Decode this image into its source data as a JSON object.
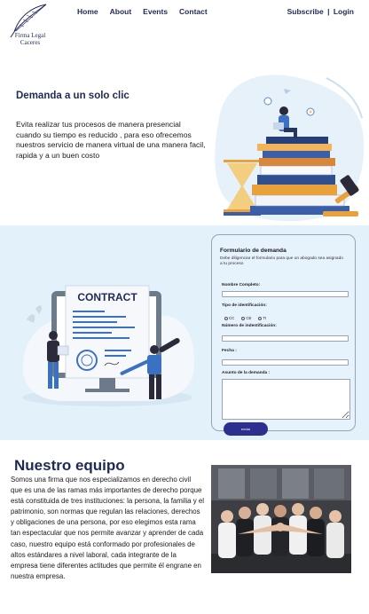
{
  "header": {
    "logo_line1": "Firma Legal",
    "logo_line2": "Caceres",
    "nav": [
      "Home",
      "About",
      "Events",
      "Contact"
    ],
    "subscribe": "Subscribe",
    "separator": "|",
    "login": "Login"
  },
  "hero": {
    "title": "Demanda a un solo clic",
    "text": "Evita realizar tus procesos de manera presencial cuando su tiempo es reducido , para eso ofrecemos nuestros servicio de manera virtual de una manera facil, rapida y a un buen costo"
  },
  "contract": {
    "sign_word": "CONTRACT"
  },
  "form": {
    "title": "Formulario de demanda",
    "subtitle": "Debe diligenciar el formulario para que un abogado sea asignado a tu proceso",
    "name_label": "Nombre Completo:",
    "id_type_label": "Tipo de identificación:",
    "id_type_options": [
      "CC",
      "CE",
      "TI"
    ],
    "id_number_label": "Número de indentificación:",
    "date_label": "Fecha :",
    "subject_label": "Asunto de la demanda :",
    "submit_label": "enviar"
  },
  "team": {
    "title": "Nuestro equipo",
    "text": "Somos una firma que nos especializamos en derecho civil que es una de las ramas más importantes de derecho porque está constituida de tres instituciones: la persona, la familia y el patrimonio, son normas que regulan las relaciones, derechos y obligaciones de una persona, por eso elegimos esta rama tan espectacular que nos permite avanzar y aprender de cada caso, nuestro equipo está conformado por profesionales de altos estándares a nivel laboral, cada integrante de la empresa tiene diferentes actitudes que permite él engrane en nuestra empresa."
  },
  "colors": {
    "brand_navy": "#1e2a56",
    "band_blue": "#e3f1fb",
    "button_blue": "#2c2f8e"
  },
  "icons": [
    "quill-logo-icon",
    "books-scales-illustration",
    "contract-illustration",
    "team-photo"
  ]
}
